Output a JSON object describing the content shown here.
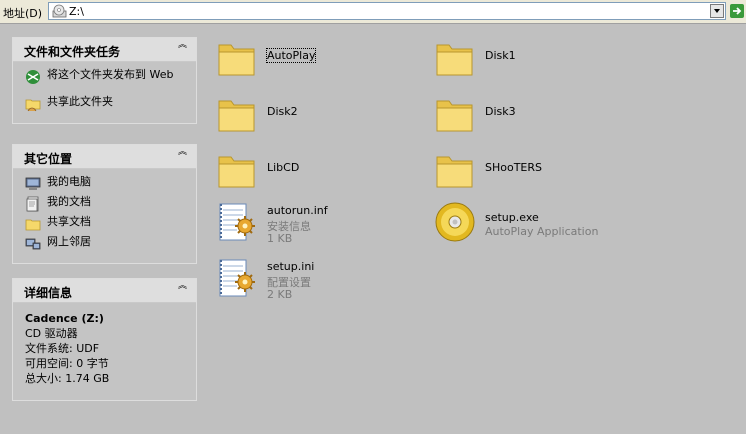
{
  "address_bar": {
    "label": "地址(D)",
    "path": "Z:\\"
  },
  "panels": {
    "tasks": {
      "title": "文件和文件夹任务",
      "items": [
        {
          "label": "将这个文件夹发布到 Web",
          "icon": "publish-web-icon"
        },
        {
          "label": "共享此文件夹",
          "icon": "share-folder-icon"
        }
      ]
    },
    "places": {
      "title": "其它位置",
      "items": [
        {
          "label": "我的电脑",
          "icon": "my-computer-icon"
        },
        {
          "label": "我的文档",
          "icon": "my-documents-icon"
        },
        {
          "label": "共享文档",
          "icon": "shared-documents-icon"
        },
        {
          "label": "网上邻居",
          "icon": "network-places-icon"
        }
      ]
    },
    "details": {
      "title": "详细信息",
      "name": "Cadence (Z:)",
      "type": "CD 驱动器",
      "fs": "文件系统: UDF",
      "free": "可用空间: 0 字节",
      "total": "总大小: 1.74 GB"
    }
  },
  "files": [
    {
      "name": "AutoPlay",
      "type": "folder"
    },
    {
      "name": "Disk1",
      "type": "folder"
    },
    {
      "name": "Disk2",
      "type": "folder"
    },
    {
      "name": "Disk3",
      "type": "folder"
    },
    {
      "name": "LibCD",
      "type": "folder"
    },
    {
      "name": "SHooTERS",
      "type": "folder"
    },
    {
      "name": "autorun.inf",
      "type": "config",
      "kind": "安装信息",
      "size": "1 KB"
    },
    {
      "name": "setup.exe",
      "type": "cd",
      "kind": "AutoPlay Application"
    },
    {
      "name": "setup.ini",
      "type": "config",
      "kind": "配置设置",
      "size": "2 KB"
    }
  ],
  "colors": {
    "background": "#c0c0c0",
    "folder_yellow": "#f5d86a",
    "subtext_gray": "#7a7a7a"
  }
}
